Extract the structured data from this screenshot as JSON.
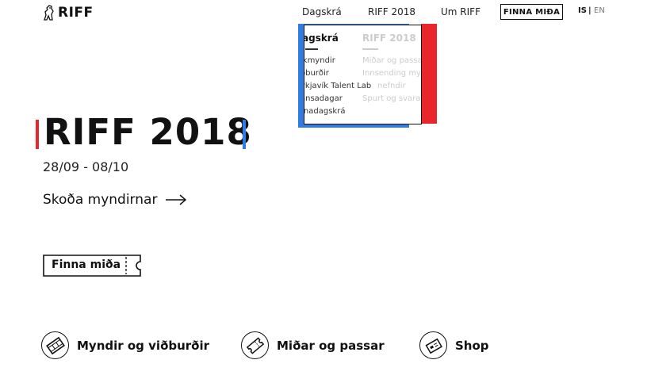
{
  "header": {
    "logo_text": "RIFF",
    "nav": [
      "Dagskrá",
      "RIFF 2018",
      "Um RIFF"
    ],
    "ticket_button": "FINNA MIÐA",
    "lang_is": "IS",
    "lang_sep": "|",
    "lang_en": "EN"
  },
  "dropdown": {
    "col1_title": "agskrá",
    "col1_items": [
      "ikmyndir",
      "ðburðir",
      "ykjavík Talent Lab",
      "ansadagar",
      "rnadagskrá"
    ],
    "col2_title": "RIFF 2018",
    "col2_items": [
      "Miðar og passar",
      "Innsending myn",
      "nefndir",
      "Spurt og svarað"
    ]
  },
  "hero": {
    "title": "RIFF 2018",
    "dates": "28/09 - 08/10",
    "cta": "Skoða myndirnar",
    "ticket_cta": "Finna miða"
  },
  "bottom_links": [
    {
      "label": "Myndir og viðburðir",
      "icon": "film-icon"
    },
    {
      "label": "Miðar og passar",
      "icon": "ticket-icon"
    },
    {
      "label": "Shop",
      "icon": "shop-icon"
    }
  ],
  "colors": {
    "red": "#e8262b",
    "blue": "#2f7de1",
    "text": "#111111"
  }
}
